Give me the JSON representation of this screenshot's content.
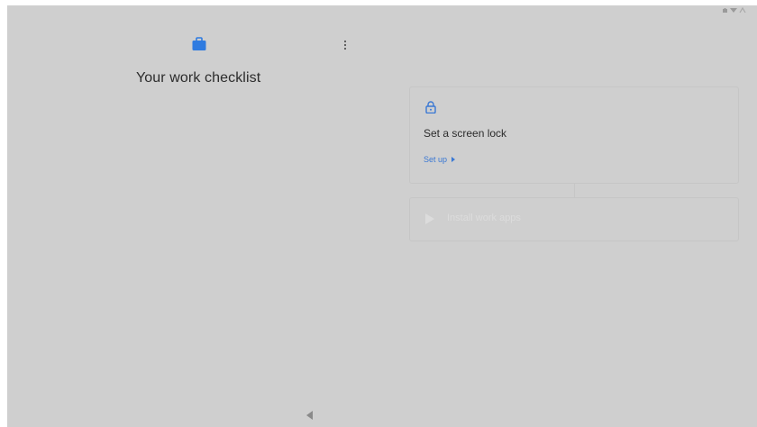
{
  "status_bar": {
    "icons": [
      "battery-icon",
      "wifi-icon",
      "signal-icon"
    ]
  },
  "header": {
    "work_icon": "briefcase-icon",
    "menu_icon": "more-vert-icon",
    "title": "Your work checklist"
  },
  "checklist": {
    "items": [
      {
        "icon": "lock-icon",
        "title": "Set a screen lock",
        "action_label": "Set up",
        "state": "active"
      },
      {
        "icon": "play-store-icon",
        "title": "Install work apps",
        "state": "disabled"
      }
    ]
  },
  "nav_bar": {
    "back_icon": "back-triangle-icon"
  },
  "colors": {
    "background": "#cfcfcf",
    "accent": "#3a78d4",
    "text": "#2c2c2c",
    "card_border": "#c6c6c6",
    "disabled_text": "#dcdcdc"
  }
}
